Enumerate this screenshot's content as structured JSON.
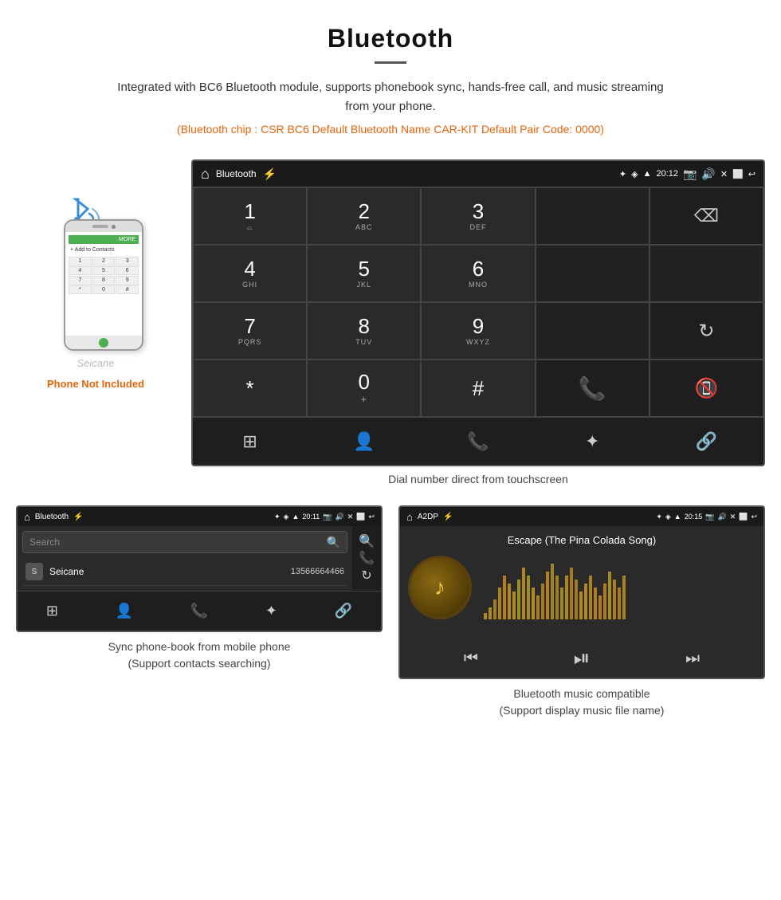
{
  "header": {
    "title": "Bluetooth",
    "description": "Integrated with BC6 Bluetooth module, supports phonebook sync, hands-free call, and music streaming from your phone.",
    "specs": "(Bluetooth chip : CSR BC6    Default Bluetooth Name CAR-KIT    Default Pair Code: 0000)"
  },
  "phone_not_included": "Phone Not Included",
  "dialpad_caption": "Dial number direct from touchscreen",
  "dialpad_screen": {
    "title": "Bluetooth",
    "time": "20:12",
    "keys": [
      {
        "main": "1",
        "sub": ""
      },
      {
        "main": "2",
        "sub": "ABC"
      },
      {
        "main": "3",
        "sub": "DEF"
      },
      {
        "main": "",
        "sub": ""
      },
      {
        "main": "⌫",
        "sub": ""
      },
      {
        "main": "4",
        "sub": "GHI"
      },
      {
        "main": "5",
        "sub": "JKL"
      },
      {
        "main": "6",
        "sub": "MNO"
      },
      {
        "main": "",
        "sub": ""
      },
      {
        "main": "",
        "sub": ""
      },
      {
        "main": "7",
        "sub": "PQRS"
      },
      {
        "main": "8",
        "sub": "TUV"
      },
      {
        "main": "9",
        "sub": "WXYZ"
      },
      {
        "main": "",
        "sub": ""
      },
      {
        "main": "↻",
        "sub": ""
      },
      {
        "main": "*",
        "sub": ""
      },
      {
        "main": "0",
        "sub": "+"
      },
      {
        "main": "#",
        "sub": ""
      },
      {
        "main": "📞",
        "sub": ""
      },
      {
        "main": "📞",
        "sub": "red"
      }
    ]
  },
  "phonebook_screen": {
    "title": "Bluetooth",
    "time": "20:11",
    "search_placeholder": "Search",
    "contact": {
      "initial": "S",
      "name": "Seicane",
      "number": "13566664466"
    }
  },
  "music_screen": {
    "title": "A2DP",
    "time": "20:15",
    "song_title": "Escape (The Pina Colada Song)"
  },
  "phonebook_caption_line1": "Sync phone-book from mobile phone",
  "phonebook_caption_line2": "(Support contacts searching)",
  "music_caption_line1": "Bluetooth music compatible",
  "music_caption_line2": "(Support display music file name)",
  "viz_bars": [
    8,
    15,
    25,
    40,
    55,
    45,
    35,
    50,
    65,
    55,
    40,
    30,
    45,
    60,
    70,
    55,
    40,
    55,
    65,
    50,
    35,
    45,
    55,
    40,
    30,
    45,
    60,
    50,
    40,
    55
  ]
}
